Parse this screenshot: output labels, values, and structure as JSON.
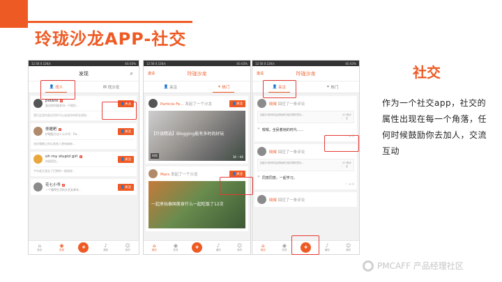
{
  "slide": {
    "title": "玲珑沙龙APP-社交"
  },
  "status": {
    "left": "12:56 0.12K/s",
    "right": "4G 63%"
  },
  "phone1": {
    "header": "发现",
    "tabs": [
      "找人",
      "找沙龙"
    ],
    "users": [
      {
        "name": "pidank",
        "badge": "V",
        "sub": "面试的时候多问一下他们...",
        "desc": "我们这里的面试问你可以谈谈你的职业规划...",
        "follow": "关注"
      },
      {
        "name": "侈嬷粑",
        "badge": "V",
        "sub": "护眼配方达人公众号：Ra...",
        "desc": "良好睡眠让你比其他人更有精神...",
        "follow": "关注"
      },
      {
        "name": "oh my stupid girl",
        "badge": "V",
        "sub": "向阳而生。",
        "desc": "今年夏天我去了巴黎的一趟旅程...",
        "follow": "关注"
      },
      {
        "name": "花七小爷",
        "badge": "V",
        "sub": "一个懂得生活的文艺女青年...",
        "desc": "",
        "follow": "关注"
      }
    ],
    "nav": [
      "首页",
      "发现",
      "",
      "通知",
      "我的"
    ]
  },
  "phone2": {
    "header_left": "邀请",
    "header": "玲珑沙龙",
    "tabs": [
      "关注",
      "热门"
    ],
    "posts": [
      {
        "name": "Particle Fe...",
        "sub": "发起了一个沙龙",
        "follow": "关注",
        "caption": "【玲珑精选】Blogging能有多时尚好玩",
        "foot": "时尚",
        "stats": "1K  ♡46"
      },
      {
        "name": "Mars",
        "sub": "发起了一个沙龙",
        "follow": "关注",
        "caption": "一起来玩泰国美食什么一起吃饭了12次",
        "foot": "",
        "stats": ""
      }
    ],
    "nav": [
      "首页",
      "发现",
      "",
      "通知",
      "我的"
    ]
  },
  "phone3": {
    "header_left": "邀请",
    "header": "玲珑沙龙",
    "tabs": [
      "关注",
      "热门"
    ],
    "posts": [
      {
        "name": "晓晓",
        "sub": "回应了一条评论",
        "quote": "回复中说你的话说啥我们给你提的意见...",
        "qnum": "10 条评论",
        "comment": "嘿嘿，全民着她的时代......",
        "actions": "♡  ✉ 0"
      },
      {
        "name": "晓晓",
        "sub": "回应了一条评论",
        "quote": "回复中说你的话说啥我们给你提的意见...",
        "qnum": "10 条评论",
        "comment": "同感同感，一起学习。",
        "actions": "♡  ✉ 0"
      },
      {
        "name": "晓晓",
        "sub": "回应了一条评论",
        "quote": "",
        "qnum": "",
        "comment": "",
        "actions": ""
      }
    ],
    "nav": [
      "首页",
      "发现",
      "",
      "通知",
      "我的"
    ]
  },
  "side": {
    "title": "社交",
    "text": "作为一个社交app，社交的属性出现在每一个角落，任何时候鼓励你去加人，交流互动"
  },
  "logo": {
    "text": "PMCAFF 产品经理社区"
  },
  "colors": {
    "accent": "#ee5a24",
    "highlight": "#e53935"
  }
}
